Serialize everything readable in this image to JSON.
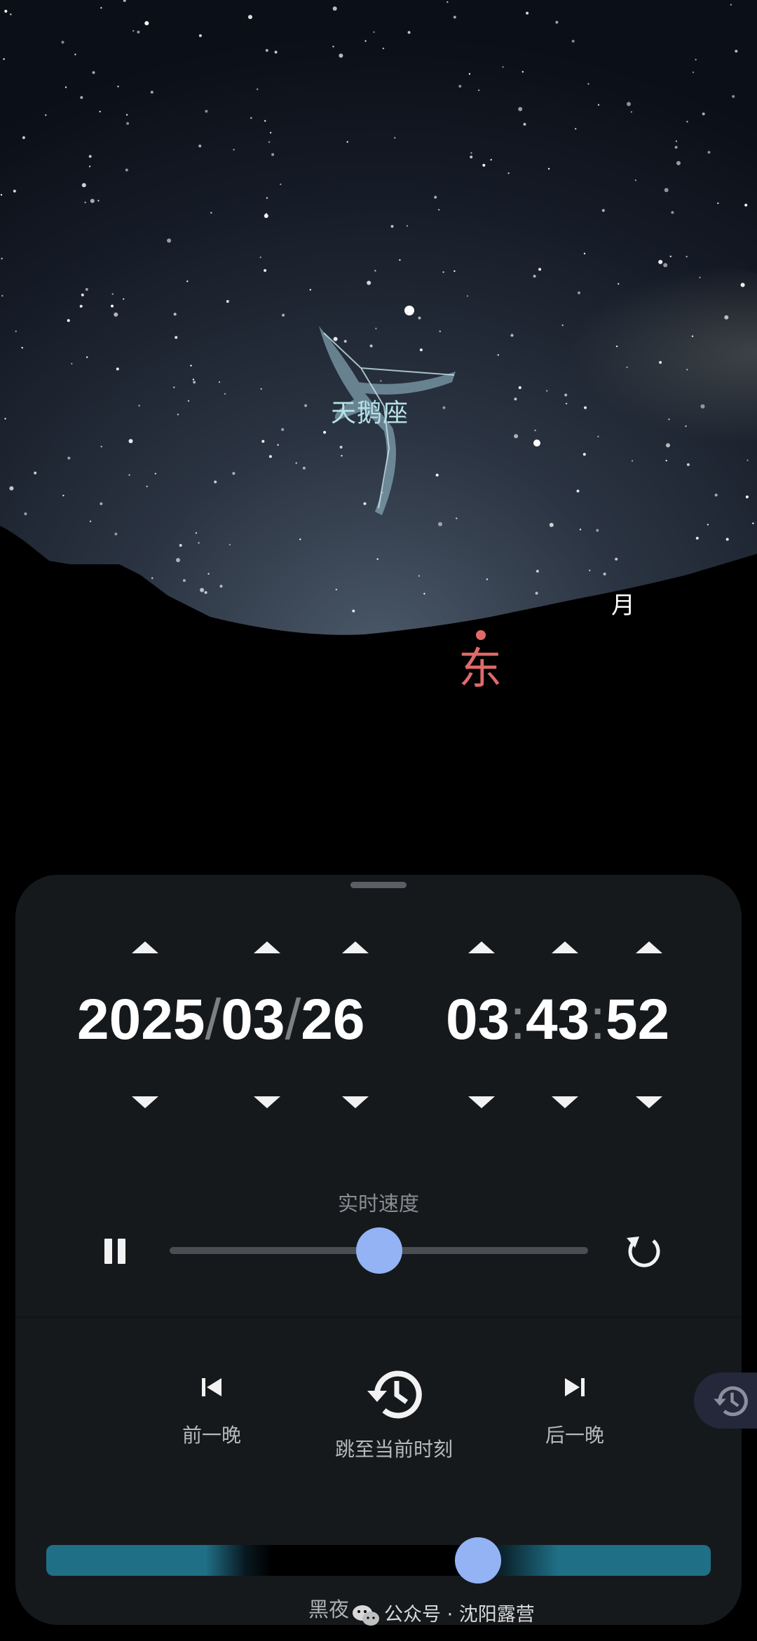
{
  "sky": {
    "constellation_name": "天鹅座",
    "direction_label": "东",
    "moon_label": "月"
  },
  "datetime": {
    "year": "2025",
    "month": "03",
    "day": "26",
    "hour": "03",
    "minute": "43",
    "second": "52",
    "date_separator": "/",
    "time_separator": ":"
  },
  "speed": {
    "label": "实时速度",
    "slider_value": 0.5
  },
  "navigation": {
    "prev_night_label": "前一晚",
    "jump_now_label": "跳至当前时刻",
    "next_night_label": "后一晚"
  },
  "twilight": {
    "state_label": "黑夜",
    "slider_value": 0.65
  },
  "watermark": "公众号 · 沈阳露营",
  "icons": {
    "pause": "pause-icon",
    "reset_speed": "reset-speed-icon",
    "prev_night": "skip-previous-icon",
    "jump_now": "history-icon",
    "next_night": "skip-next-icon",
    "fab": "history-icon",
    "watermark": "wechat-icon"
  },
  "colors": {
    "accent": "#93b3f5",
    "twilight": "#1f6f86",
    "direction": "#e06a6a",
    "constellation": "#b4e2e6"
  }
}
